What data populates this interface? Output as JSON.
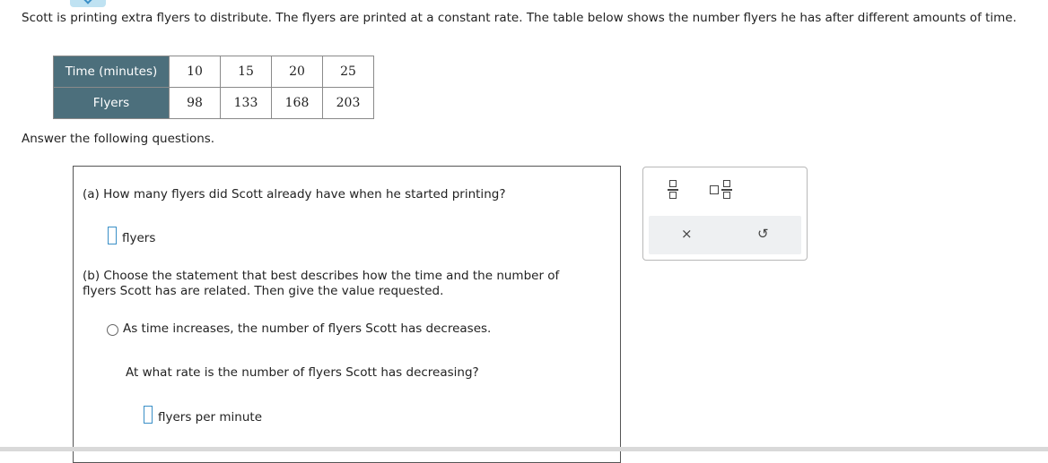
{
  "prompt": "Scott is printing extra flyers to distribute. The flyers are printed at a constant rate. The table below shows the number flyers he has after different amounts of time.",
  "table": {
    "row_headers": [
      "Time (minutes)",
      "Flyers"
    ],
    "time": [
      "10",
      "15",
      "20",
      "25"
    ],
    "flyers": [
      "98",
      "133",
      "168",
      "203"
    ]
  },
  "answer_label": "Answer the following questions.",
  "part_a": {
    "question": "(a) How many flyers did Scott already have when he started printing?",
    "input_value": "",
    "unit": "flyers"
  },
  "part_b": {
    "question": "(b) Choose the statement that best describes how the time and the number of flyers Scott has are related. Then give the value requested.",
    "option": "As time increases, the number of flyers Scott has decreases.",
    "followup": "At what rate is the number of flyers Scott has decreasing?",
    "input_value": "",
    "unit": "flyers per minute"
  },
  "tools": {
    "icons": [
      "fraction-icon",
      "mixed-number-icon",
      "clear-icon",
      "undo-icon"
    ],
    "clear_glyph": "×",
    "undo_glyph": "↺"
  }
}
